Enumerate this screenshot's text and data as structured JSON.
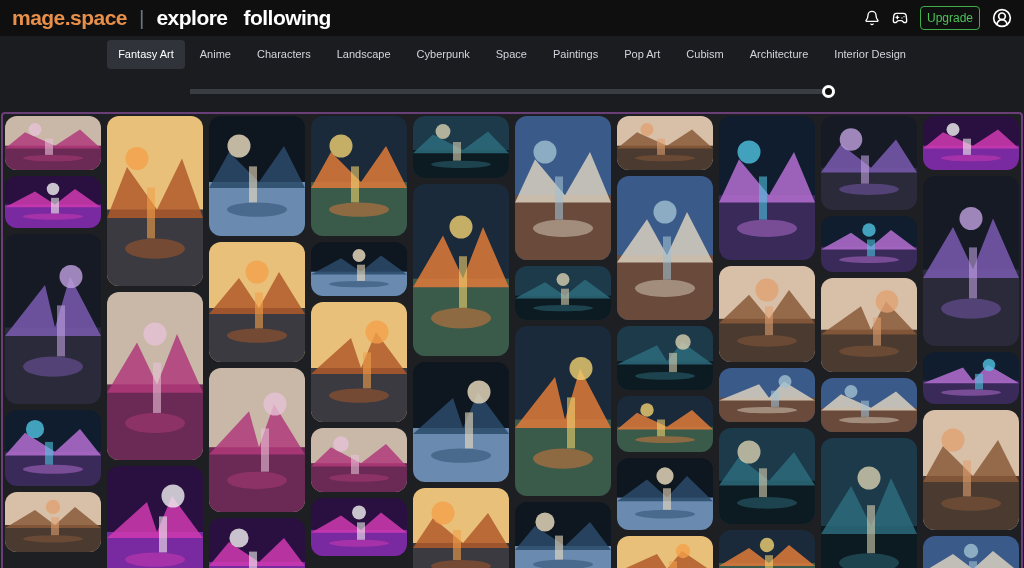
{
  "header": {
    "logo": "mage.space",
    "separator": "|",
    "nav": [
      {
        "label": "explore"
      },
      {
        "label": "following"
      }
    ],
    "upgrade": "Upgrade"
  },
  "tabs": [
    {
      "label": "Fantasy Art",
      "selected": true
    },
    {
      "label": "Anime",
      "selected": false
    },
    {
      "label": "Characters",
      "selected": false
    },
    {
      "label": "Landscape",
      "selected": false
    },
    {
      "label": "Cyberpunk",
      "selected": false
    },
    {
      "label": "Space",
      "selected": false
    },
    {
      "label": "Paintings",
      "selected": false
    },
    {
      "label": "Pop Art",
      "selected": false
    },
    {
      "label": "Cubism",
      "selected": false
    },
    {
      "label": "Architecture",
      "selected": false
    },
    {
      "label": "Interior Design",
      "selected": false
    }
  ],
  "slider": {
    "level": 1
  }
}
